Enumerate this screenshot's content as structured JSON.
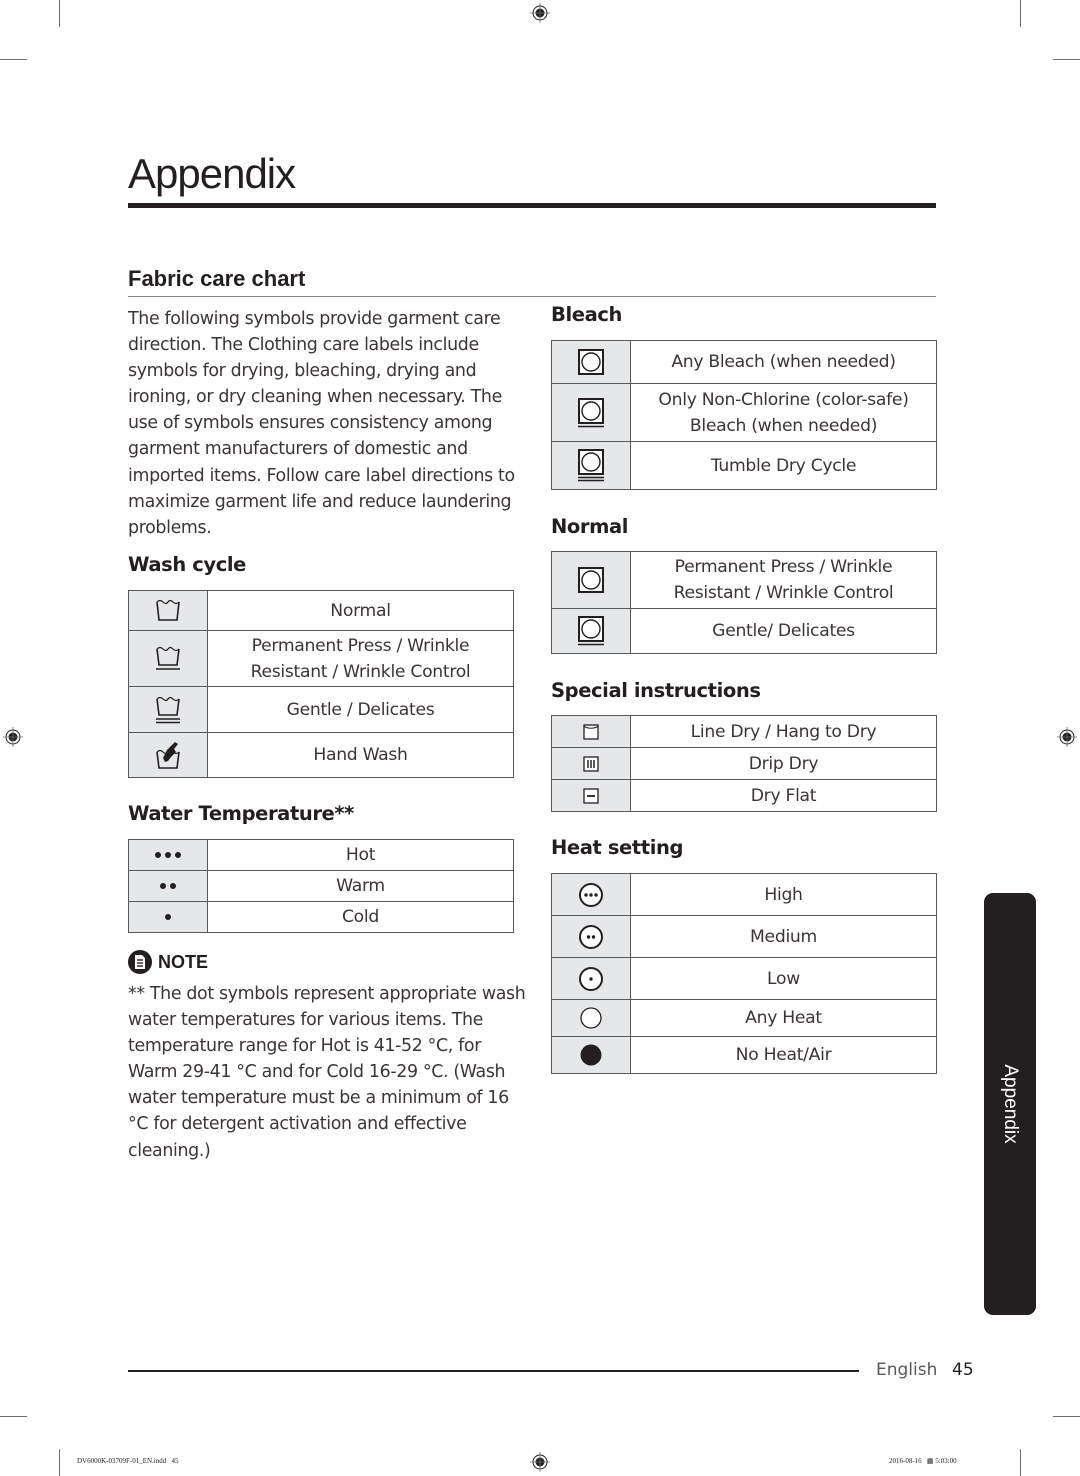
{
  "page": {
    "title": "Appendix",
    "section_title": "Fabric care chart",
    "intro": "The following symbols provide garment care direction. The Clothing care labels include symbols for drying, bleaching, drying and ironing, or dry cleaning when necessary. The use of symbols ensures consistency among garment manufacturers of domestic and imported items. Follow care label directions to maximize garment life and reduce laundering problems."
  },
  "wash_cycle": {
    "heading": "Wash cycle",
    "rows": [
      {
        "icon": "washtub-normal-icon",
        "label": "Normal"
      },
      {
        "icon": "washtub-permanent-press-icon",
        "label": "Permanent Press / Wrinkle Resistant / Wrinkle Control"
      },
      {
        "icon": "washtub-gentle-icon",
        "label": "Gentle / Delicates"
      },
      {
        "icon": "washtub-hand-wash-icon",
        "label": "Hand Wash"
      }
    ]
  },
  "water_temperature": {
    "heading": "Water Temperature**",
    "rows": [
      {
        "icon": "three-dots-icon",
        "label": "Hot"
      },
      {
        "icon": "two-dots-icon",
        "label": "Warm"
      },
      {
        "icon": "one-dot-icon",
        "label": "Cold"
      }
    ]
  },
  "note": {
    "label": "NOTE",
    "icon": "note-icon",
    "text": "** The dot symbols represent appropriate wash water temperatures for various items. The temperature range for Hot is 41-52 °C, for Warm 29-41 °C and for Cold 16-29 °C. (Wash water temperature must be a minimum of 16 °C for detergent activation and effective cleaning.)"
  },
  "bleach": {
    "heading": "Bleach",
    "rows": [
      {
        "icon": "tumble-dry-icon",
        "label": "Any Bleach (when needed)"
      },
      {
        "icon": "tumble-dry-one-bar-icon",
        "label": "Only Non-Chlorine (color-safe) Bleach (when needed)"
      },
      {
        "icon": "tumble-dry-two-bars-icon",
        "label": "Tumble Dry Cycle"
      }
    ]
  },
  "normal": {
    "heading": "Normal",
    "rows": [
      {
        "icon": "tumble-dry-icon",
        "label": "Permanent Press / Wrinkle Resistant / Wrinkle Control"
      },
      {
        "icon": "tumble-dry-one-bar-icon",
        "label": "Gentle/ Delicates"
      }
    ]
  },
  "special_instructions": {
    "heading": "Special instructions",
    "rows": [
      {
        "icon": "line-dry-icon",
        "label": "Line Dry / Hang to Dry"
      },
      {
        "icon": "drip-dry-icon",
        "label": "Drip Dry"
      },
      {
        "icon": "dry-flat-icon",
        "label": "Dry Flat"
      }
    ]
  },
  "heat_setting": {
    "heading": "Heat setting",
    "rows": [
      {
        "icon": "heat-high-icon",
        "label": "High"
      },
      {
        "icon": "heat-medium-icon",
        "label": "Medium"
      },
      {
        "icon": "heat-low-icon",
        "label": "Low"
      },
      {
        "icon": "heat-any-icon",
        "label": "Any Heat"
      },
      {
        "icon": "heat-none-icon",
        "label": "No Heat/Air"
      }
    ]
  },
  "side_tab": {
    "label": "Appendix"
  },
  "footer": {
    "language": "English",
    "page_number": "45",
    "slug_file": "DV6000K-03709F-01_EN.indd   45",
    "slug_date": "2016-08-16   ▦ 5:03:00"
  },
  "colors": {
    "text": "#231f20",
    "icon_cell_bg": "#e6e7e8",
    "border": "#58595b",
    "tab_bg": "#231f20"
  }
}
